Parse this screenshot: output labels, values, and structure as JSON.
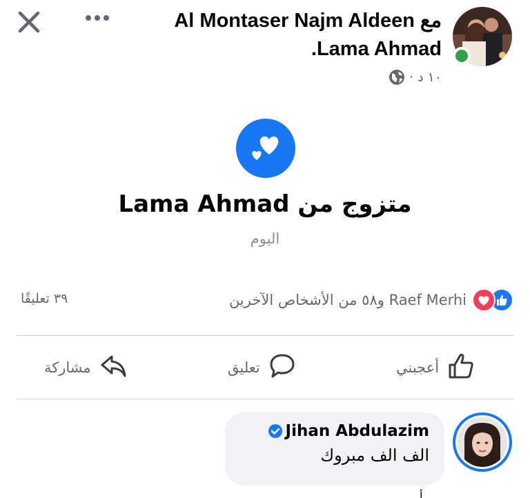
{
  "topbar": {
    "close_icon": "close-icon",
    "more_icon": "more-horizontal-icon"
  },
  "post": {
    "line1_name": "Al Montaser Najm Aldeen",
    "line1_with": "مع",
    "line2_tagged": "Lama Ahmad",
    "line2_end": ".",
    "time": "١٠ د",
    "separator": "·",
    "privacy_icon": "globe-icon"
  },
  "life_event": {
    "icon": "hearts-icon",
    "title_prefix": "متزوج من",
    "title_name": "Lama Ahmad",
    "date": "اليوم"
  },
  "reactions": {
    "text": "Raef Merhi و٥٨ من الأشخاص الآخرين",
    "comments_count": "٣٩ تعليقًا",
    "colors": {
      "like": "#1877f2",
      "love": "#f33e58"
    }
  },
  "actions": {
    "like": "أعجبني",
    "comment": "تعليق",
    "share": "مشاركة"
  },
  "comment": {
    "author": "Jihan Abdulazim",
    "text": "الف الف مبروك",
    "cut_text": "أ"
  },
  "colors": {
    "accent": "#1877f2",
    "online": "#31a24c"
  }
}
